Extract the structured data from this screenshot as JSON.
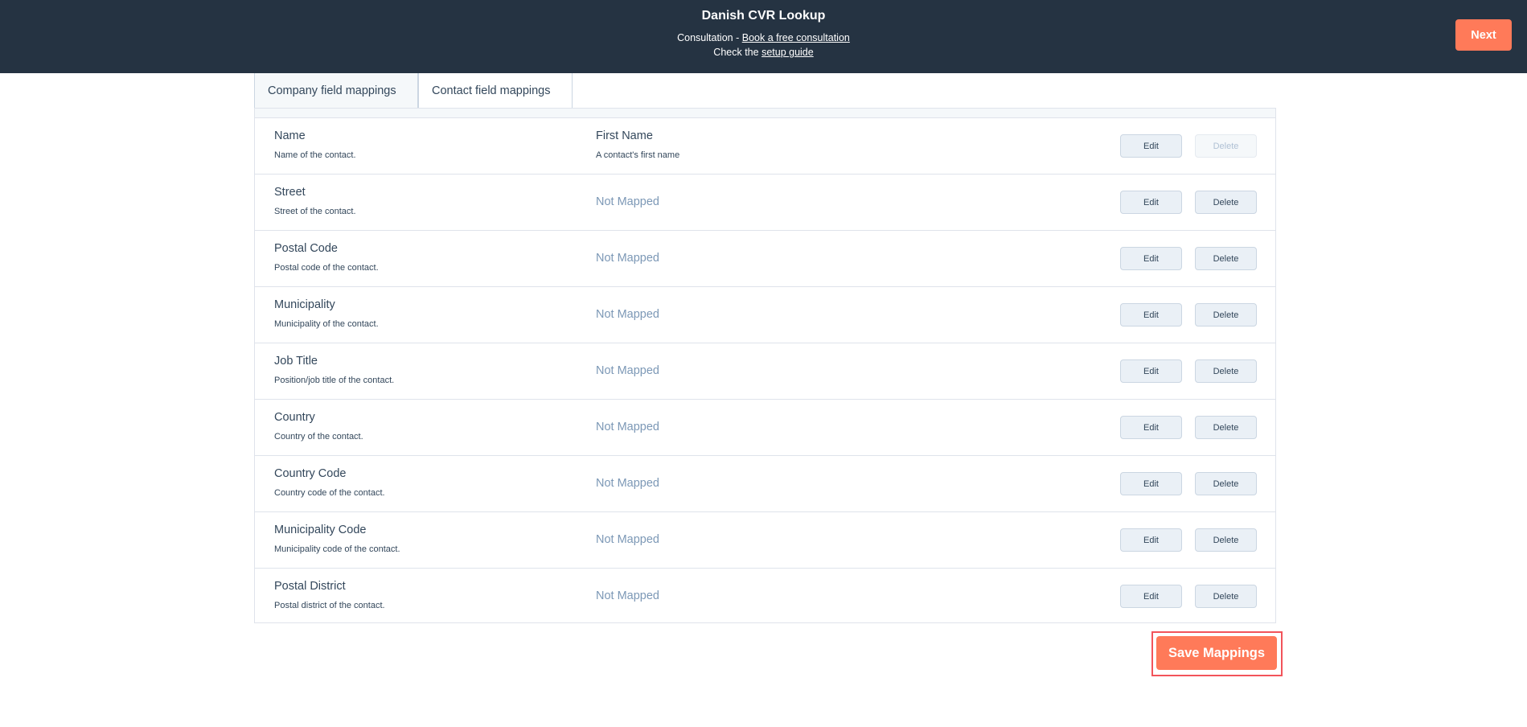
{
  "header": {
    "title": "Danish CVR Lookup",
    "consultation_prefix": "Consultation - ",
    "consultation_link": "Book a free consultation",
    "guide_prefix": "Check the ",
    "guide_link": "setup guide",
    "next_label": "Next"
  },
  "tabs": [
    {
      "label": "Company field mappings",
      "active": false
    },
    {
      "label": "Contact field mappings",
      "active": true
    }
  ],
  "rows": [
    {
      "field": "Name",
      "description": "Name of the contact.",
      "mapped_to": "First Name",
      "mapped_description": "A contact's first name",
      "edit_label": "Edit",
      "delete_label": "Delete",
      "delete_disabled": true
    },
    {
      "field": "Street",
      "description": "Street of the contact.",
      "status": "Not Mapped",
      "edit_label": "Edit",
      "delete_label": "Delete"
    },
    {
      "field": "Postal Code",
      "description": "Postal code of the contact.",
      "status": "Not Mapped",
      "edit_label": "Edit",
      "delete_label": "Delete"
    },
    {
      "field": "Municipality",
      "description": "Municipality of the contact.",
      "status": "Not Mapped",
      "edit_label": "Edit",
      "delete_label": "Delete"
    },
    {
      "field": "Job Title",
      "description": "Position/job title of the contact.",
      "status": "Not Mapped",
      "edit_label": "Edit",
      "delete_label": "Delete"
    },
    {
      "field": "Country",
      "description": "Country of the contact.",
      "status": "Not Mapped",
      "edit_label": "Edit",
      "delete_label": "Delete"
    },
    {
      "field": "Country Code",
      "description": "Country code of the contact.",
      "status": "Not Mapped",
      "edit_label": "Edit",
      "delete_label": "Delete"
    },
    {
      "field": "Municipality Code",
      "description": "Municipality code of the contact.",
      "status": "Not Mapped",
      "edit_label": "Edit",
      "delete_label": "Delete"
    },
    {
      "field": "Postal District",
      "description": "Postal district of the contact.",
      "status": "Not Mapped",
      "edit_label": "Edit",
      "delete_label": "Delete"
    }
  ],
  "save_label": "Save Mappings",
  "colors": {
    "header_bg": "#253342",
    "accent": "#ff7a59",
    "highlight_outline": "#f2545b",
    "not_mapped_text": "#7c98b6"
  }
}
